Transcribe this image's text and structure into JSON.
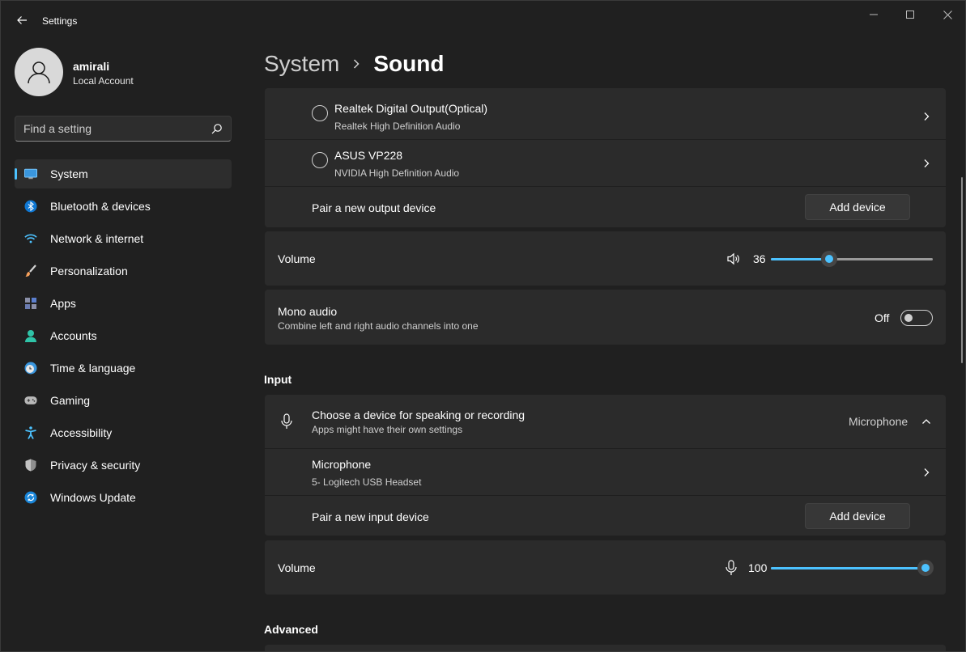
{
  "window": {
    "title": "Settings"
  },
  "profile": {
    "name": "amirali",
    "account_type": "Local Account"
  },
  "search": {
    "placeholder": "Find a setting"
  },
  "sidebar": {
    "items": [
      {
        "label": "System",
        "icon": "system-icon",
        "active": true
      },
      {
        "label": "Bluetooth & devices",
        "icon": "bluetooth-icon"
      },
      {
        "label": "Network & internet",
        "icon": "wifi-icon"
      },
      {
        "label": "Personalization",
        "icon": "brush-icon"
      },
      {
        "label": "Apps",
        "icon": "apps-icon"
      },
      {
        "label": "Accounts",
        "icon": "accounts-icon"
      },
      {
        "label": "Time & language",
        "icon": "clock-globe-icon"
      },
      {
        "label": "Gaming",
        "icon": "gamepad-icon"
      },
      {
        "label": "Accessibility",
        "icon": "accessibility-icon"
      },
      {
        "label": "Privacy & security",
        "icon": "shield-icon"
      },
      {
        "label": "Windows Update",
        "icon": "update-icon"
      }
    ]
  },
  "breadcrumb": {
    "parent": "System",
    "current": "Sound"
  },
  "output": {
    "devices": [
      {
        "name": "Realtek Digital Output(Optical)",
        "driver": "Realtek High Definition Audio"
      },
      {
        "name": "ASUS VP228",
        "driver": "NVIDIA High Definition Audio"
      }
    ],
    "pair_label": "Pair a new output device",
    "add_button": "Add device",
    "volume_label": "Volume",
    "volume_value": "36",
    "volume_level": 0.36,
    "mono_label": "Mono audio",
    "mono_sub": "Combine left and right audio channels into one",
    "mono_state": "Off"
  },
  "input": {
    "section_title": "Input",
    "choose_label": "Choose a device for speaking or recording",
    "choose_sub": "Apps might have their own settings",
    "selected_device": "Microphone",
    "device_name": "Microphone",
    "device_sub": "5- Logitech USB Headset",
    "pair_label": "Pair a new input device",
    "add_button": "Add device",
    "volume_label": "Volume",
    "volume_value": "100",
    "volume_level": 1.0
  },
  "advanced": {
    "section_title": "Advanced"
  },
  "colors": {
    "accent": "#4cc2ff",
    "background": "#202020",
    "card": "#2b2b2b"
  }
}
